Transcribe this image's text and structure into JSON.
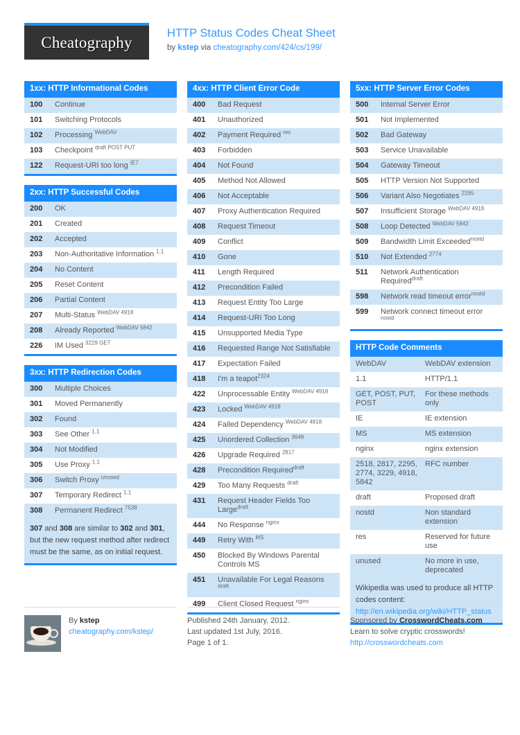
{
  "header": {
    "logo_text": "Cheatography",
    "title": "HTTP Status Codes Cheat Sheet",
    "by_label": "by",
    "author": "kstep",
    "via_label": "via",
    "source_url": "cheatography.com/424/cs/199/"
  },
  "sections": {
    "s1xx": {
      "title": "1xx: HTTP Informational Codes",
      "rows": [
        {
          "code": "100",
          "desc": "Continue",
          "sup": ""
        },
        {
          "code": "101",
          "desc": "Switching Protocols",
          "sup": ""
        },
        {
          "code": "102",
          "desc": "Processing ",
          "sup": "WebDAV"
        },
        {
          "code": "103",
          "desc": "Checkpoint ",
          "sup": "draft POST PUT"
        },
        {
          "code": "122",
          "desc": "Request-URI too long ",
          "sup": "IE7"
        }
      ]
    },
    "s2xx": {
      "title": "2xx: HTTP Successful Codes",
      "rows": [
        {
          "code": "200",
          "desc": "OK",
          "sup": ""
        },
        {
          "code": "201",
          "desc": "Created",
          "sup": ""
        },
        {
          "code": "202",
          "desc": "Accepted",
          "sup": ""
        },
        {
          "code": "203",
          "desc": "Non-Authoritative Information ",
          "sup": "1.1"
        },
        {
          "code": "204",
          "desc": "No Content",
          "sup": ""
        },
        {
          "code": "205",
          "desc": "Reset Content",
          "sup": ""
        },
        {
          "code": "206",
          "desc": "Partial Content",
          "sup": ""
        },
        {
          "code": "207",
          "desc": "Multi-Status ",
          "sup": "WebDAV 4918"
        },
        {
          "code": "208",
          "desc": "Already Reported ",
          "sup": "WebDAV 5842"
        },
        {
          "code": "226",
          "desc": "IM Used ",
          "sup": "3229 GET"
        }
      ]
    },
    "s3xx": {
      "title": "3xx: HTTP Redirection Codes",
      "rows": [
        {
          "code": "300",
          "desc": "Multiple Choices",
          "sup": ""
        },
        {
          "code": "301",
          "desc": "Moved Permanently",
          "sup": ""
        },
        {
          "code": "302",
          "desc": "Found",
          "sup": ""
        },
        {
          "code": "303",
          "desc": "See Other ",
          "sup": "1.1"
        },
        {
          "code": "304",
          "desc": "Not Modified",
          "sup": ""
        },
        {
          "code": "305",
          "desc": "Use Proxy ",
          "sup": "1.1"
        },
        {
          "code": "306",
          "desc": "Switch Proxy ",
          "sup": "unused"
        },
        {
          "code": "307",
          "desc": "Temporary Redirect ",
          "sup": "1.1"
        },
        {
          "code": "308",
          "desc": "Permanent Redirect ",
          "sup": "7538"
        }
      ],
      "note_html": "<b>307</b> and <b>308</b> are similar to <b>302</b> and <b>301</b>, but the new request method after redirect must be the same, as on initial request."
    },
    "s4xx": {
      "title": "4xx: HTTP Client Error Code",
      "rows": [
        {
          "code": "400",
          "desc": "Bad Request",
          "sup": ""
        },
        {
          "code": "401",
          "desc": "Unauthorized",
          "sup": ""
        },
        {
          "code": "402",
          "desc": "Payment Required ",
          "sup": "res"
        },
        {
          "code": "403",
          "desc": "Forbidden",
          "sup": ""
        },
        {
          "code": "404",
          "desc": "Not Found",
          "sup": ""
        },
        {
          "code": "405",
          "desc": "Method Not Allowed",
          "sup": ""
        },
        {
          "code": "406",
          "desc": "Not Acceptable",
          "sup": ""
        },
        {
          "code": "407",
          "desc": "Proxy Authentication Required",
          "sup": ""
        },
        {
          "code": "408",
          "desc": "Request Timeout",
          "sup": ""
        },
        {
          "code": "409",
          "desc": "Conflict",
          "sup": ""
        },
        {
          "code": "410",
          "desc": "Gone",
          "sup": ""
        },
        {
          "code": "411",
          "desc": "Length Required",
          "sup": ""
        },
        {
          "code": "412",
          "desc": "Precondition Failed",
          "sup": ""
        },
        {
          "code": "413",
          "desc": "Request Entity Too Large",
          "sup": ""
        },
        {
          "code": "414",
          "desc": "Request-URI Too Long",
          "sup": ""
        },
        {
          "code": "415",
          "desc": "Unsupported Media Type",
          "sup": ""
        },
        {
          "code": "416",
          "desc": "Requested Range Not Satisfiable",
          "sup": ""
        },
        {
          "code": "417",
          "desc": "Expectation Failed",
          "sup": ""
        },
        {
          "code": "418",
          "desc": "I'm a teapot",
          "sup": "2324"
        },
        {
          "code": "422",
          "desc": "Unprocessable Entity ",
          "sup": "WebDAV 4918"
        },
        {
          "code": "423",
          "desc": "Locked ",
          "sup": "WebDAV 4918"
        },
        {
          "code": "424",
          "desc": "Failed Dependency ",
          "sup": "WebDAV 4918"
        },
        {
          "code": "425",
          "desc": "Unordered Collection ",
          "sup": "3648"
        },
        {
          "code": "426",
          "desc": "Upgrade Required ",
          "sup": "2817"
        },
        {
          "code": "428",
          "desc": "Precondition Required",
          "sup": "draft"
        },
        {
          "code": "429",
          "desc": "Too Many Requests ",
          "sup": "draft"
        },
        {
          "code": "431",
          "desc": "Request Header Fields Too Large",
          "sup": "draft"
        },
        {
          "code": "444",
          "desc": "No Response ",
          "sup": "nginx"
        },
        {
          "code": "449",
          "desc": "Retry With ",
          "sup": "MS"
        },
        {
          "code": "450",
          "desc": "Blocked By Windows Parental Controls MS",
          "sup": ""
        },
        {
          "code": "451",
          "desc": "Unavailable For Legal Reasons ",
          "sup": "draft"
        },
        {
          "code": "499",
          "desc": "Client Closed Request ",
          "sup": "nginx"
        }
      ]
    },
    "s5xx": {
      "title": "5xx: HTTP Server Error Codes",
      "rows": [
        {
          "code": "500",
          "desc": "Internal Server Error",
          "sup": ""
        },
        {
          "code": "501",
          "desc": "Not Implemented",
          "sup": ""
        },
        {
          "code": "502",
          "desc": "Bad Gateway",
          "sup": ""
        },
        {
          "code": "503",
          "desc": "Service Unavailable",
          "sup": ""
        },
        {
          "code": "504",
          "desc": "Gateway Timeout",
          "sup": ""
        },
        {
          "code": "505",
          "desc": "HTTP Version Not Supported",
          "sup": ""
        },
        {
          "code": "506",
          "desc": "Variant Also Negotiates ",
          "sup": "2295"
        },
        {
          "code": "507",
          "desc": "Insufficient Storage ",
          "sup": "WebDAV 4918"
        },
        {
          "code": "508",
          "desc": "Loop Detected ",
          "sup": "WebDAV 5842"
        },
        {
          "code": "509",
          "desc": "Bandwidth Limit Exceeded",
          "sup": "nostd"
        },
        {
          "code": "510",
          "desc": "Not Extended ",
          "sup": "2774"
        },
        {
          "code": "511",
          "desc": "Network Authentication Required",
          "sup": "draft"
        },
        {
          "code": "598",
          "desc": "Network read timeout error",
          "sup": "nostd"
        },
        {
          "code": "599",
          "desc": "Network connect timeout error ",
          "sup": "nostd"
        }
      ]
    },
    "comments": {
      "title": "HTTP Code Comments",
      "rows": [
        {
          "k": "WebDAV",
          "v": "WebDAV extension"
        },
        {
          "k": "1.1",
          "v": "HTTP/1.1"
        },
        {
          "k": "GET, POST, PUT, POST",
          "v": "For these methods only"
        },
        {
          "k": "IE",
          "v": "IE extension"
        },
        {
          "k": "MS",
          "v": "MS extension"
        },
        {
          "k": "nginx",
          "v": "nginx extension"
        },
        {
          "k": "2518, 2817, 2295, 2774, 3229, 4918, 5842",
          "v": "RFC number"
        },
        {
          "k": "draft",
          "v": "Proposed draft"
        },
        {
          "k": "nostd",
          "v": "Non standard extension"
        },
        {
          "k": "res",
          "v": "Reserved for future use"
        },
        {
          "k": "unused",
          "v": "No more in use, deprecated"
        }
      ],
      "note_text": "Wikipedia was used to produce all HTTP codes content:",
      "note_link": "http://en.wikipedia.org/wiki/HTTP_status"
    }
  },
  "footer": {
    "author_prefix": "By",
    "author_name": "kstep",
    "author_url": "cheatography.com/kstep/",
    "published": "Published 24th January, 2012.",
    "updated": "Last updated 1st July, 2016.",
    "page": "Page 1 of 1.",
    "sponsor_prefix": "Sponsored by",
    "sponsor_name": "CrosswordCheats.com",
    "sponsor_tagline": "Learn to solve cryptic crosswords!",
    "sponsor_url": "http://crosswordcheats.com"
  },
  "colors": {
    "accent": "#1a8cff",
    "row_alt": "#cde4f7",
    "link": "#3399ff",
    "logo_bg": "#333333"
  }
}
